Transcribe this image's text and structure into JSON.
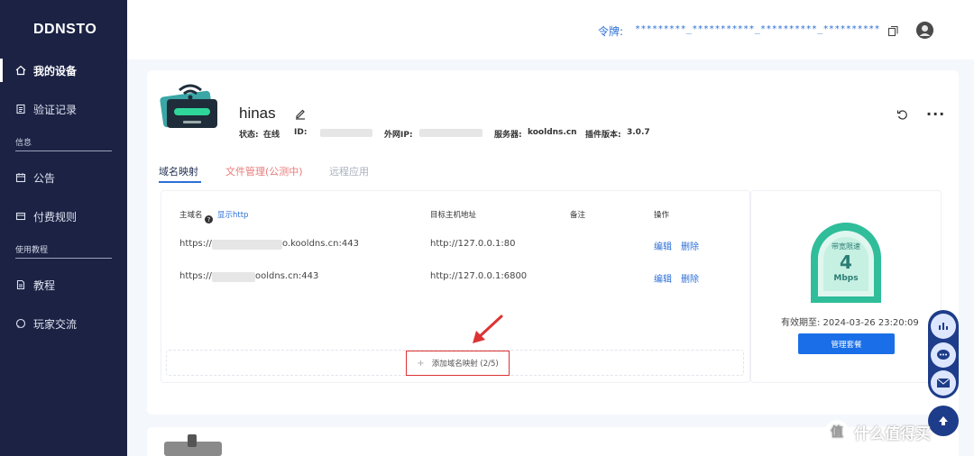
{
  "app": {
    "title": "DDNSTO"
  },
  "sidebar": {
    "items": [
      {
        "label": "我的设备",
        "icon": "home-icon"
      },
      {
        "label": "验证记录",
        "icon": "document-icon"
      },
      {
        "label": "公告",
        "icon": "calendar-icon"
      },
      {
        "label": "付费规则",
        "icon": "card-icon"
      },
      {
        "label": "教程",
        "icon": "file-icon"
      },
      {
        "label": "玩家交流",
        "icon": "chat-icon"
      }
    ],
    "sections": [
      "信息",
      "使用教程"
    ]
  },
  "header": {
    "token_label": "令牌:",
    "token_value": "*********_***********_**********_**********"
  },
  "device": {
    "name": "hinas",
    "status_label": "状态:",
    "status_value": "在线",
    "id_label": "ID:",
    "ip_label": "外网IP:",
    "server_label": "服务器:",
    "server_value": "kooldns.cn",
    "plugin_label": "插件版本:",
    "plugin_value": "3.0.7"
  },
  "tabs": [
    "域名映射",
    "文件管理(公测中)",
    "远程应用"
  ],
  "table": {
    "headers": {
      "domain": "主域名",
      "show_http": "显示http",
      "target": "目标主机地址",
      "note": "备注",
      "action": "操作"
    },
    "rows": [
      {
        "domain_prefix": "https://",
        "domain_suffix": "o.kooldns.cn:443",
        "target": "http://127.0.0.1:80",
        "edit": "编辑",
        "delete": "删除"
      },
      {
        "domain_prefix": "https://",
        "domain_suffix": "ooldns.cn:443",
        "target": "http://127.0.0.1:6800",
        "edit": "编辑",
        "delete": "删除"
      }
    ],
    "add_label": "添加域名映射 (2/5)"
  },
  "bandwidth": {
    "label": "带宽限速",
    "value": "4",
    "unit": "Mbps",
    "expire": "有效期至: 2024-03-26 23:20:09",
    "manage_label": "管理套餐"
  },
  "watermark": {
    "text": "什么值得买",
    "logo": "值"
  },
  "colors": {
    "sidebar": "#1b2244",
    "accent": "#2d6fd6",
    "primary_button": "#1a6fe8",
    "gauge": "#2fbd9a",
    "highlight": "#d33333"
  }
}
